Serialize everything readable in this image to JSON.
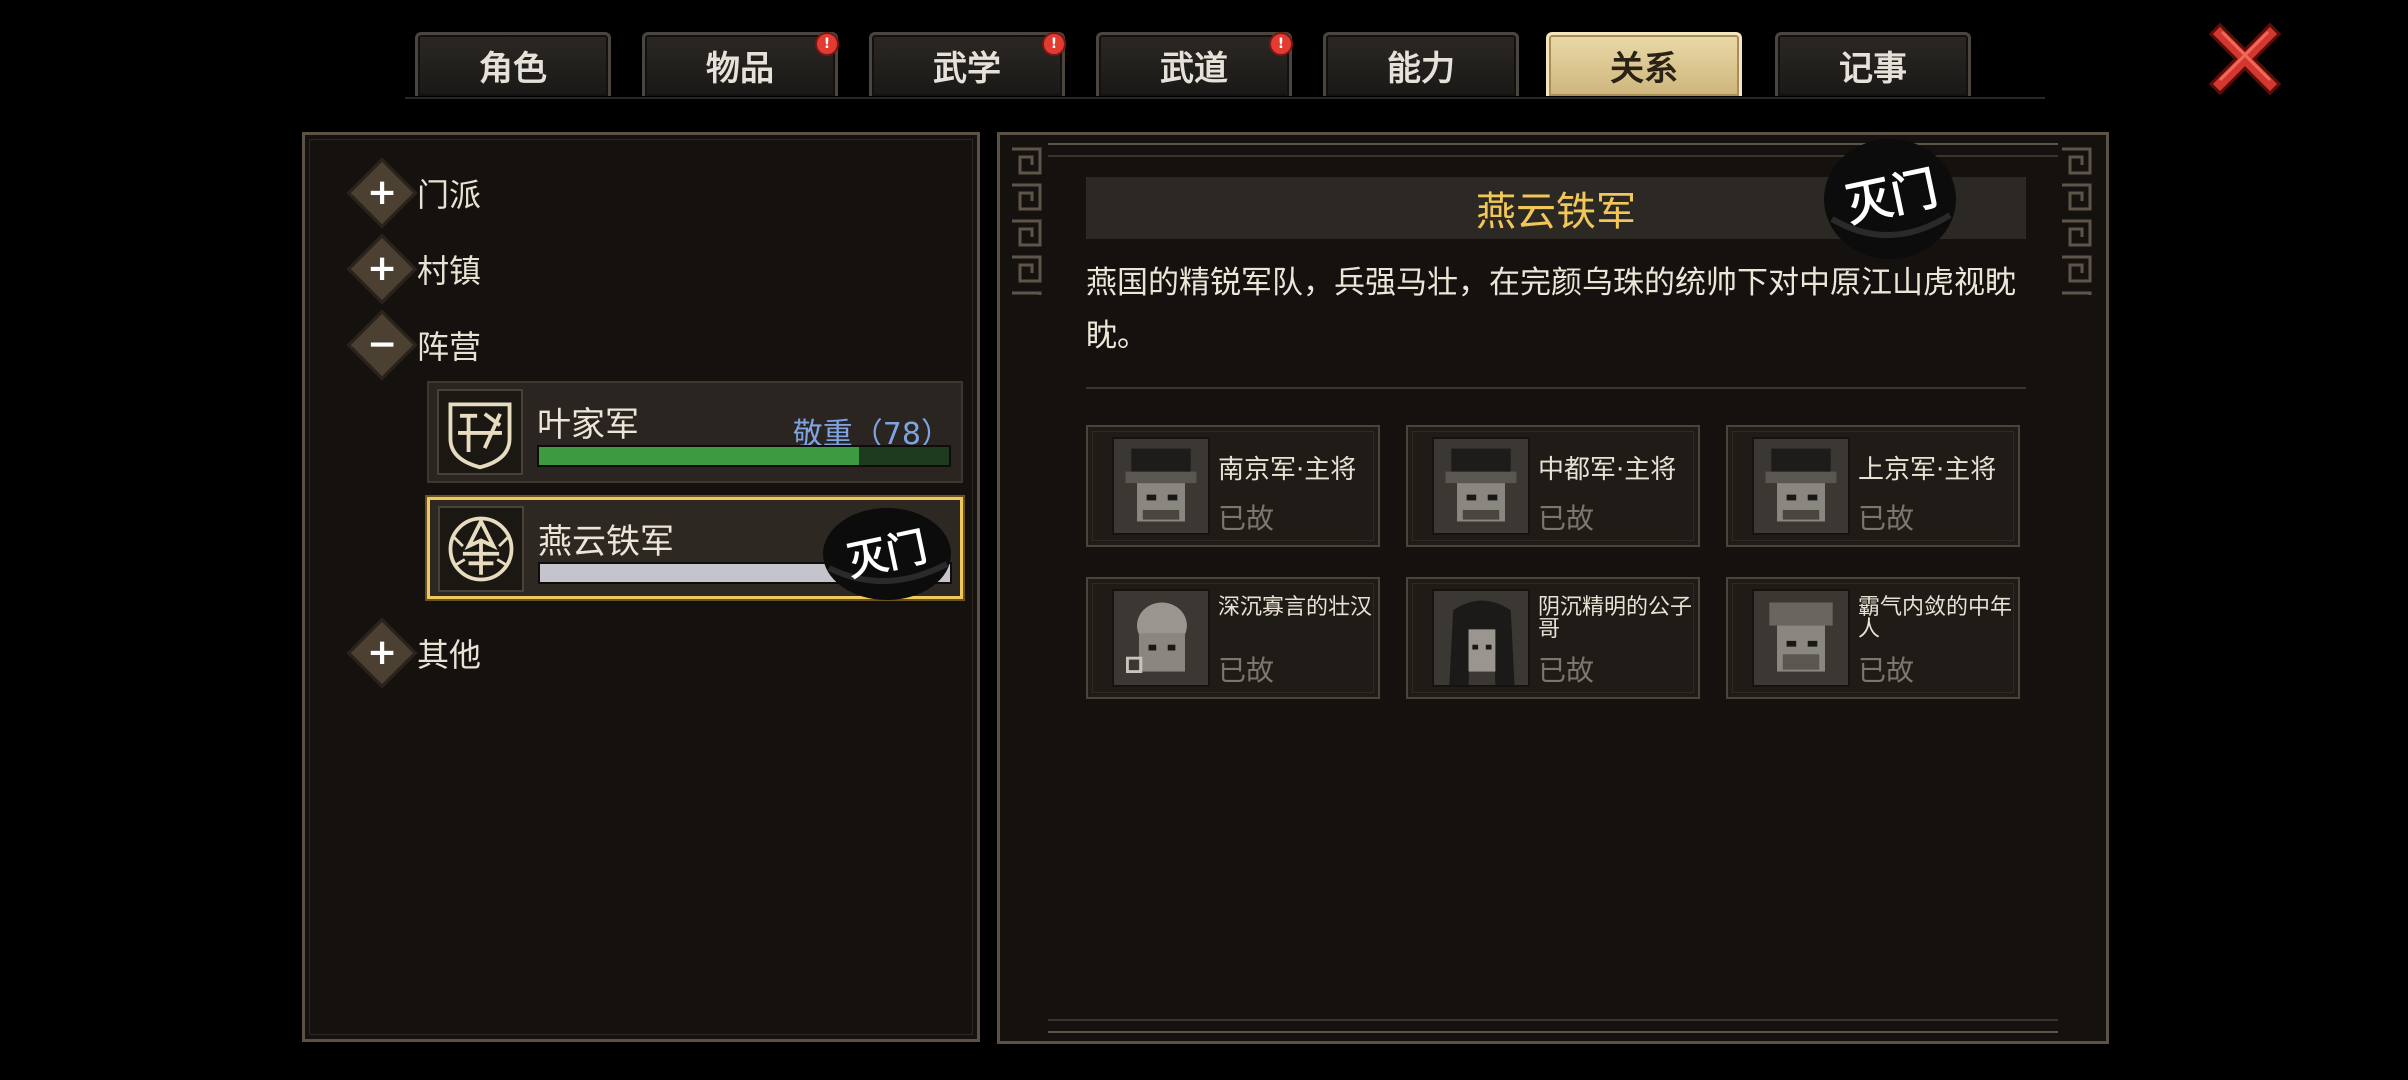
{
  "tabs": [
    {
      "label": "角色",
      "badge": false,
      "active": false
    },
    {
      "label": "物品",
      "badge": true,
      "active": false
    },
    {
      "label": "武学",
      "badge": true,
      "active": false
    },
    {
      "label": "武道",
      "badge": true,
      "active": false
    },
    {
      "label": "能力",
      "badge": false,
      "active": false
    },
    {
      "label": "关系",
      "badge": false,
      "active": true
    },
    {
      "label": "记事",
      "badge": false,
      "active": false
    }
  ],
  "badge_symbol": "!",
  "categories": {
    "menpai": {
      "label": "门派",
      "icon": "plus-icon",
      "expanded": false
    },
    "cunzhen": {
      "label": "村镇",
      "icon": "plus-icon",
      "expanded": false
    },
    "zhenying": {
      "label": "阵营",
      "icon": "minus-icon",
      "expanded": true
    },
    "qita": {
      "label": "其他",
      "icon": "plus-icon",
      "expanded": false
    }
  },
  "factions": [
    {
      "name": "叶家军",
      "reputation": "敬重（78）",
      "bar_fraction": 0.78,
      "selected": false,
      "destroyed": false
    },
    {
      "name": "燕云铁军",
      "reputation": "",
      "bar_fraction": 1.0,
      "selected": true,
      "destroyed": true
    }
  ],
  "stamp_text": "灭门",
  "detail": {
    "title": "燕云铁军",
    "description": "燕国的精锐军队，兵强马壮，在完颜乌珠的统帅下对中原江山虎视眈眈。",
    "members": [
      {
        "name": "南京军·主将",
        "status": "已故"
      },
      {
        "name": "中都军·主将",
        "status": "已故"
      },
      {
        "name": "上京军·主将",
        "status": "已故"
      },
      {
        "name": "深沉寡言的壮汉",
        "status": "已故"
      },
      {
        "name": "阴沉精明的公子哥",
        "status": "已故"
      },
      {
        "name": "霸气内敛的中年人",
        "status": "已故"
      }
    ]
  },
  "colors": {
    "accent_gold": "#f2c75a",
    "reputation_blue": "#7fa3e0",
    "bar_green": "#3e9a40",
    "badge_red": "#e23b32",
    "close_red": "#c8322c"
  }
}
